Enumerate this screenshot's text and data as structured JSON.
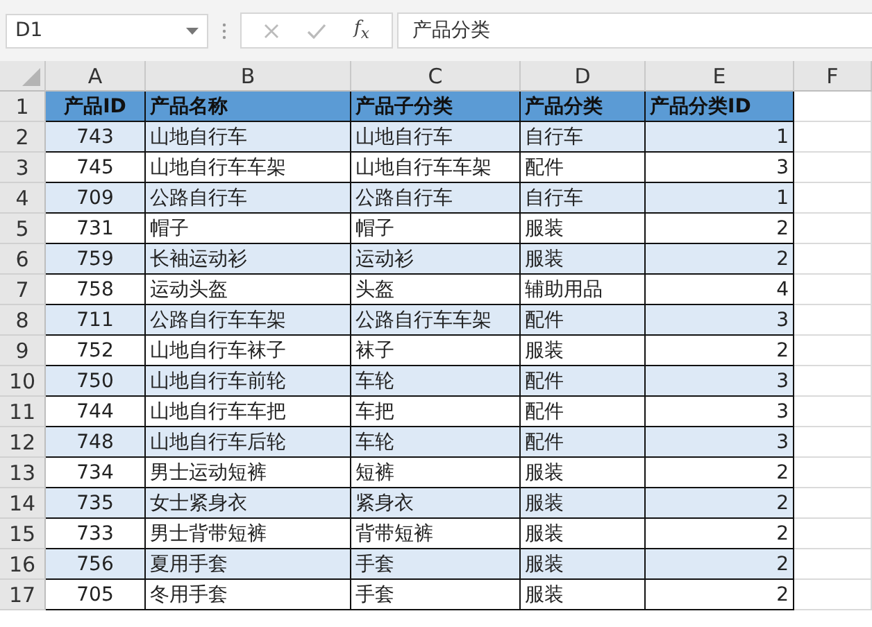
{
  "name_box": "D1",
  "formula_bar": {
    "function_label": "f$_{x}$",
    "value": "产品分类"
  },
  "columns": [
    "A",
    "B",
    "C",
    "D",
    "E",
    "F"
  ],
  "rows": [
    {
      "number": "1",
      "kind": "header",
      "cells": [
        "产品ID",
        "产品名称",
        "产品子分类",
        "产品分类",
        "产品分类ID"
      ]
    },
    {
      "number": "2",
      "kind": "data",
      "shaded": true,
      "cells": [
        "743",
        "山地自行车",
        "山地自行车",
        "自行车",
        "1"
      ]
    },
    {
      "number": "3",
      "kind": "data",
      "shaded": false,
      "cells": [
        "745",
        "山地自行车车架",
        "山地自行车车架",
        "配件",
        "3"
      ]
    },
    {
      "number": "4",
      "kind": "data",
      "shaded": true,
      "cells": [
        "709",
        "公路自行车",
        "公路自行车",
        "自行车",
        "1"
      ]
    },
    {
      "number": "5",
      "kind": "data",
      "shaded": false,
      "cells": [
        "731",
        "帽子",
        "帽子",
        "服装",
        "2"
      ]
    },
    {
      "number": "6",
      "kind": "data",
      "shaded": true,
      "cells": [
        "759",
        "长袖运动衫",
        "运动衫",
        "服装",
        "2"
      ]
    },
    {
      "number": "7",
      "kind": "data",
      "shaded": false,
      "cells": [
        "758",
        "运动头盔",
        "头盔",
        "辅助用品",
        "4"
      ]
    },
    {
      "number": "8",
      "kind": "data",
      "shaded": true,
      "cells": [
        "711",
        "公路自行车车架",
        "公路自行车车架",
        "配件",
        "3"
      ]
    },
    {
      "number": "9",
      "kind": "data",
      "shaded": false,
      "cells": [
        "752",
        "山地自行车袜子",
        "袜子",
        "服装",
        "2"
      ]
    },
    {
      "number": "10",
      "kind": "data",
      "shaded": true,
      "cells": [
        "750",
        "山地自行车前轮",
        "车轮",
        "配件",
        "3"
      ]
    },
    {
      "number": "11",
      "kind": "data",
      "shaded": false,
      "cells": [
        "744",
        "山地自行车车把",
        "车把",
        "配件",
        "3"
      ]
    },
    {
      "number": "12",
      "kind": "data",
      "shaded": true,
      "cells": [
        "748",
        "山地自行车后轮",
        "车轮",
        "配件",
        "3"
      ]
    },
    {
      "number": "13",
      "kind": "data",
      "shaded": false,
      "cells": [
        "734",
        "男士运动短裤",
        "短裤",
        "服装",
        "2"
      ]
    },
    {
      "number": "14",
      "kind": "data",
      "shaded": true,
      "cells": [
        "735",
        "女士紧身衣",
        "紧身衣",
        "服装",
        "2"
      ]
    },
    {
      "number": "15",
      "kind": "data",
      "shaded": false,
      "cells": [
        "733",
        "男士背带短裤",
        "背带短裤",
        "服装",
        "2"
      ]
    },
    {
      "number": "16",
      "kind": "data",
      "shaded": true,
      "cells": [
        "756",
        "夏用手套",
        "手套",
        "服装",
        "2"
      ]
    },
    {
      "number": "17",
      "kind": "data",
      "shaded": false,
      "cells": [
        "705",
        "冬用手套",
        "手套",
        "服装",
        "2"
      ]
    }
  ]
}
